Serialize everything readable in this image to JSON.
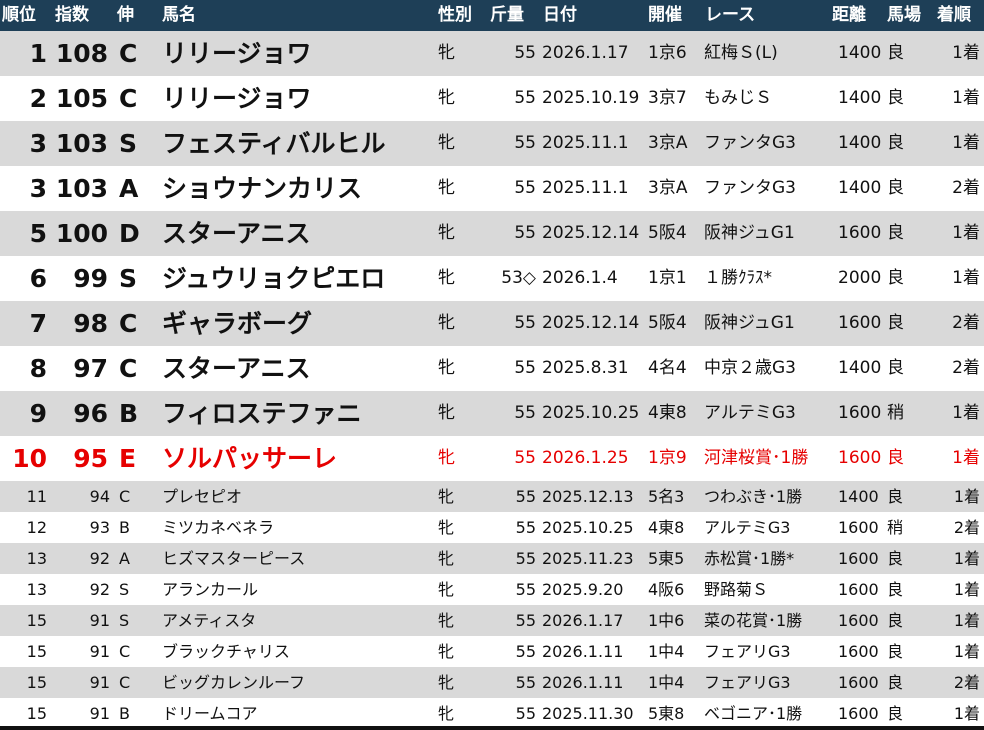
{
  "headers": {
    "rank": "順位",
    "index": "指数",
    "ext": "伸",
    "name": "馬名",
    "sex": "性別",
    "kin": "斤量",
    "date": "日付",
    "kaisai": "開催",
    "race": "レース",
    "dist": "距離",
    "baba": "馬場",
    "chaku": "着順"
  },
  "rows": [
    {
      "rank": "1",
      "index": "108",
      "ext": "C",
      "name": "リリージョワ",
      "sex": "牝",
      "kin": "55",
      "date": "2026.1.17",
      "kaisai": "1京6",
      "race": "紅梅Ｓ(L)",
      "dist": "1400",
      "baba": "良",
      "chaku": "1着"
    },
    {
      "rank": "2",
      "index": "105",
      "ext": "C",
      "name": "リリージョワ",
      "sex": "牝",
      "kin": "55",
      "date": "2025.10.19",
      "kaisai": "3京7",
      "race": "もみじＳ",
      "dist": "1400",
      "baba": "良",
      "chaku": "1着"
    },
    {
      "rank": "3",
      "index": "103",
      "ext": "S",
      "name": "フェスティバルヒル",
      "sex": "牝",
      "kin": "55",
      "date": "2025.11.1",
      "kaisai": "3京A",
      "race": "ファンタG3",
      "dist": "1400",
      "baba": "良",
      "chaku": "1着"
    },
    {
      "rank": "3",
      "index": "103",
      "ext": "A",
      "name": "ショウナンカリス",
      "sex": "牝",
      "kin": "55",
      "date": "2025.11.1",
      "kaisai": "3京A",
      "race": "ファンタG3",
      "dist": "1400",
      "baba": "良",
      "chaku": "2着"
    },
    {
      "rank": "5",
      "index": "100",
      "ext": "D",
      "name": "スターアニス",
      "sex": "牝",
      "kin": "55",
      "date": "2025.12.14",
      "kaisai": "5阪4",
      "race": "阪神ジュG1",
      "dist": "1600",
      "baba": "良",
      "chaku": "1着"
    },
    {
      "rank": "6",
      "index": "99",
      "ext": "S",
      "name": "ジュウリョクピエロ",
      "sex": "牝",
      "kin": "53◇",
      "date": "2026.1.4",
      "kaisai": "1京1",
      "race": "１勝ｸﾗｽ*",
      "dist": "2000",
      "baba": "良",
      "chaku": "1着"
    },
    {
      "rank": "7",
      "index": "98",
      "ext": "C",
      "name": "ギャラボーグ",
      "sex": "牝",
      "kin": "55",
      "date": "2025.12.14",
      "kaisai": "5阪4",
      "race": "阪神ジュG1",
      "dist": "1600",
      "baba": "良",
      "chaku": "2着"
    },
    {
      "rank": "8",
      "index": "97",
      "ext": "C",
      "name": "スターアニス",
      "sex": "牝",
      "kin": "55",
      "date": "2025.8.31",
      "kaisai": "4名4",
      "race": "中京２歳G3",
      "dist": "1400",
      "baba": "良",
      "chaku": "2着"
    },
    {
      "rank": "9",
      "index": "96",
      "ext": "B",
      "name": "フィロステファニ",
      "sex": "牝",
      "kin": "55",
      "date": "2025.10.25",
      "kaisai": "4東8",
      "race": "アルテミG3",
      "dist": "1600",
      "baba": "稍",
      "chaku": "1着"
    },
    {
      "rank": "10",
      "index": "95",
      "ext": "E",
      "name": "ソルパッサーレ",
      "sex": "牝",
      "kin": "55",
      "date": "2026.1.25",
      "kaisai": "1京9",
      "race": "河津桜賞･1勝",
      "dist": "1600",
      "baba": "良",
      "chaku": "1着"
    },
    {
      "rank": "11",
      "index": "94",
      "ext": "C",
      "name": "プレセピオ",
      "sex": "牝",
      "kin": "55",
      "date": "2025.12.13",
      "kaisai": "5名3",
      "race": "つわぶき･1勝",
      "dist": "1400",
      "baba": "良",
      "chaku": "1着"
    },
    {
      "rank": "12",
      "index": "93",
      "ext": "B",
      "name": "ミツカネベネラ",
      "sex": "牝",
      "kin": "55",
      "date": "2025.10.25",
      "kaisai": "4東8",
      "race": "アルテミG3",
      "dist": "1600",
      "baba": "稍",
      "chaku": "2着"
    },
    {
      "rank": "13",
      "index": "92",
      "ext": "A",
      "name": "ヒズマスターピース",
      "sex": "牝",
      "kin": "55",
      "date": "2025.11.23",
      "kaisai": "5東5",
      "race": "赤松賞･1勝*",
      "dist": "1600",
      "baba": "良",
      "chaku": "1着"
    },
    {
      "rank": "13",
      "index": "92",
      "ext": "S",
      "name": "アランカール",
      "sex": "牝",
      "kin": "55",
      "date": "2025.9.20",
      "kaisai": "4阪6",
      "race": "野路菊Ｓ",
      "dist": "1600",
      "baba": "良",
      "chaku": "1着"
    },
    {
      "rank": "15",
      "index": "91",
      "ext": "S",
      "name": "アメティスタ",
      "sex": "牝",
      "kin": "55",
      "date": "2026.1.17",
      "kaisai": "1中6",
      "race": "菜の花賞･1勝",
      "dist": "1600",
      "baba": "良",
      "chaku": "1着"
    },
    {
      "rank": "15",
      "index": "91",
      "ext": "C",
      "name": "ブラックチャリス",
      "sex": "牝",
      "kin": "55",
      "date": "2026.1.11",
      "kaisai": "1中4",
      "race": "フェアリG3",
      "dist": "1600",
      "baba": "良",
      "chaku": "1着"
    },
    {
      "rank": "15",
      "index": "91",
      "ext": "C",
      "name": "ビッグカレンルーフ",
      "sex": "牝",
      "kin": "55",
      "date": "2026.1.11",
      "kaisai": "1中4",
      "race": "フェアリG3",
      "dist": "1600",
      "baba": "良",
      "chaku": "2着"
    },
    {
      "rank": "15",
      "index": "91",
      "ext": "B",
      "name": "ドリームコア",
      "sex": "牝",
      "kin": "55",
      "date": "2025.11.30",
      "kaisai": "5東8",
      "race": "ベゴニア･1勝",
      "dist": "1600",
      "baba": "良",
      "chaku": "1着"
    }
  ],
  "colors": {
    "header_bg": "#1e3f57",
    "header_text": "#ffffff",
    "band_gray": "#d9d9d9",
    "highlight_red": "#e60000"
  }
}
